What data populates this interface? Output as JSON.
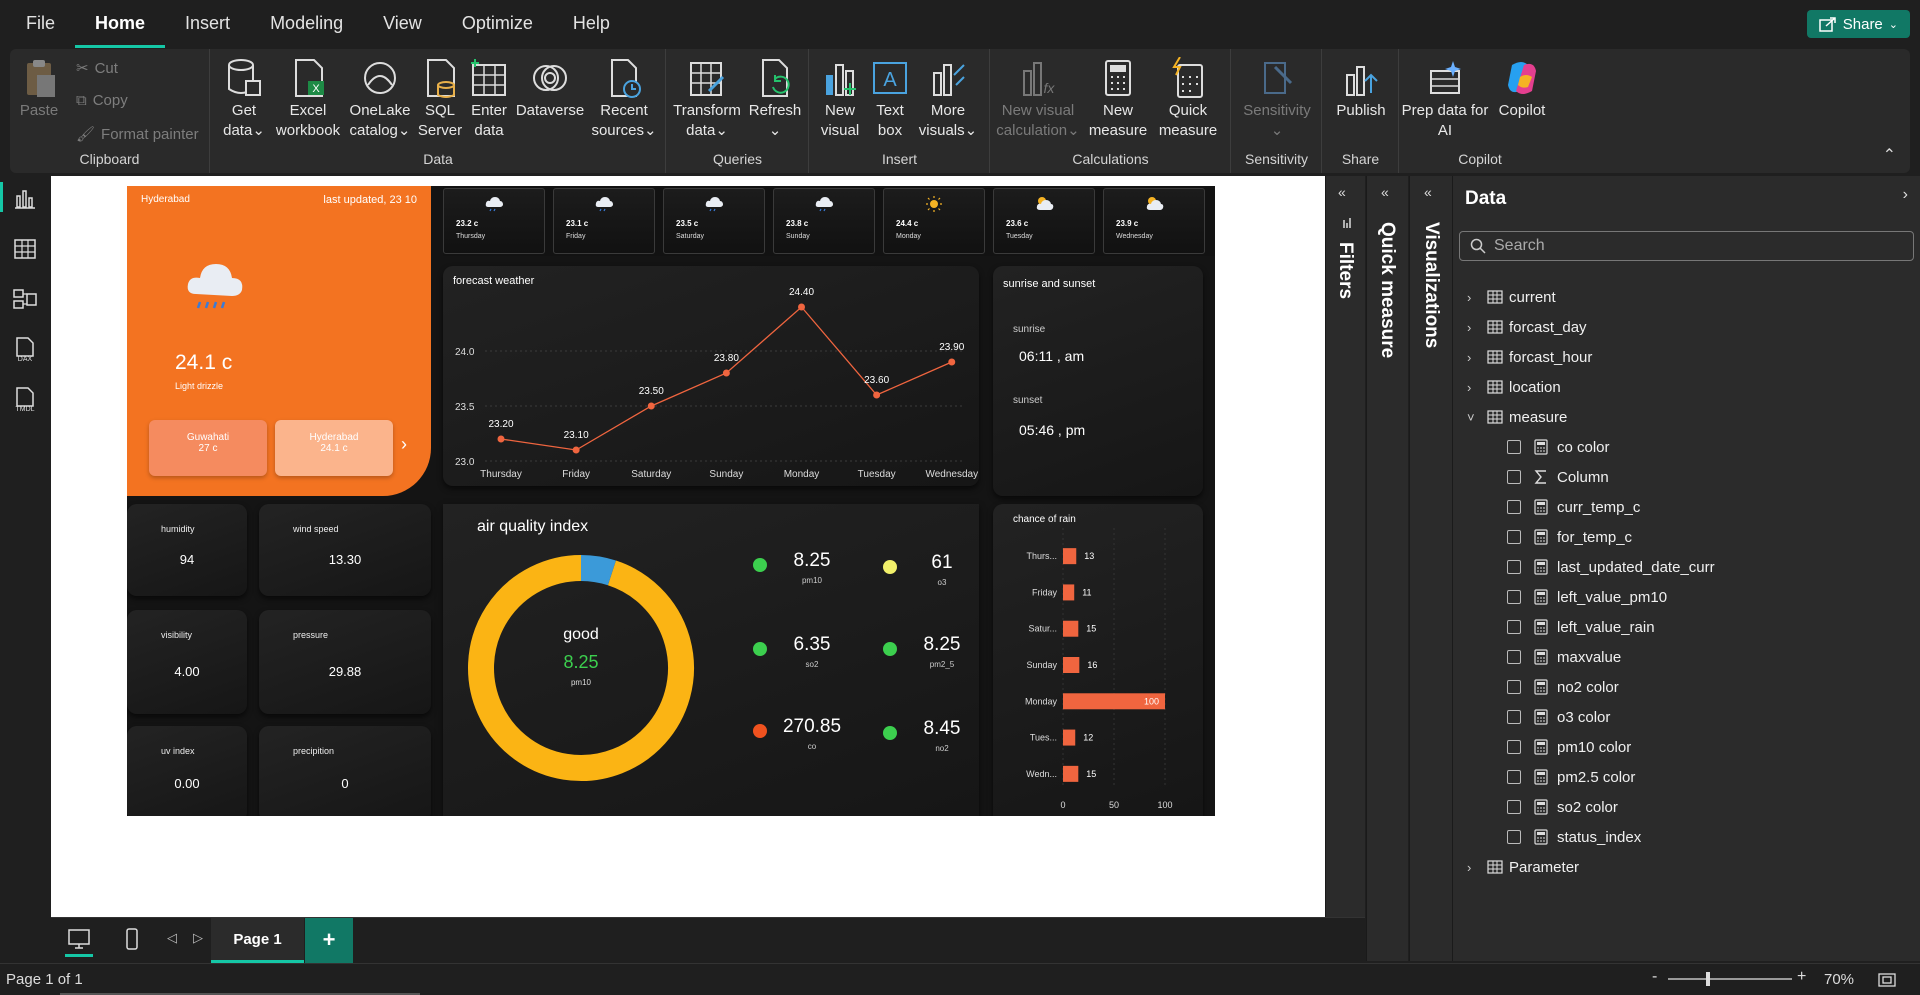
{
  "menu": {
    "items": [
      "File",
      "Home",
      "Insert",
      "Modeling",
      "View",
      "Optimize",
      "Help"
    ],
    "active": "Home",
    "share": "Share"
  },
  "ribbon": {
    "clipboard": {
      "paste": "Paste",
      "cut": "Cut",
      "copy": "Copy",
      "format_painter": "Format painter",
      "label": "Clipboard"
    },
    "data": {
      "get_data": [
        "Get",
        "data"
      ],
      "excel": [
        "Excel",
        "workbook"
      ],
      "onelake": [
        "OneLake",
        "catalog"
      ],
      "sql": [
        "SQL",
        "Server"
      ],
      "enter": [
        "Enter",
        "data"
      ],
      "dataverse": "Dataverse",
      "recent": [
        "Recent",
        "sources"
      ],
      "label": "Data"
    },
    "queries": {
      "transform": [
        "Transform",
        "data"
      ],
      "refresh": "Refresh",
      "label": "Queries"
    },
    "insert": {
      "new_visual": [
        "New",
        "visual"
      ],
      "text_box": [
        "Text",
        "box"
      ],
      "more_visuals": [
        "More",
        "visuals"
      ],
      "label": "Insert"
    },
    "calculations": {
      "new_visual_calc": [
        "New visual",
        "calculation"
      ],
      "new_measure": [
        "New",
        "measure"
      ],
      "quick_measure": [
        "Quick",
        "measure"
      ],
      "label": "Calculations"
    },
    "sensitivity": {
      "btn": "Sensitivity",
      "label": "Sensitivity"
    },
    "share": {
      "publish": "Publish",
      "label": "Share"
    },
    "copilot": {
      "prep": [
        "Prep data for",
        "AI"
      ],
      "copilot": "Copilot",
      "label": "Copilot"
    }
  },
  "report": {
    "current": {
      "city": "Hyderabad",
      "last_updated": "last updated, 23 10",
      "temp": "24.1 c",
      "condition": "Light drizzle",
      "cities": [
        {
          "name": "Guwahati",
          "temp": "27 c"
        },
        {
          "name": "Hyderabad",
          "temp": "24.1 c"
        }
      ]
    },
    "daily": [
      {
        "temp": "23.2 c",
        "day": "Thursday",
        "icon": "cloud-rain-icon"
      },
      {
        "temp": "23.1 c",
        "day": "Friday",
        "icon": "cloud-rain-icon"
      },
      {
        "temp": "23.5 c",
        "day": "Saturday",
        "icon": "cloud-rain-icon"
      },
      {
        "temp": "23.8 c",
        "day": "Sunday",
        "icon": "cloud-rain-icon"
      },
      {
        "temp": "24.4 c",
        "day": "Monday",
        "icon": "sun-icon"
      },
      {
        "temp": "23.6 c",
        "day": "Tuesday",
        "icon": "partly-cloudy-icon"
      },
      {
        "temp": "23.9 c",
        "day": "Wednesday",
        "icon": "partly-cloudy-icon"
      }
    ],
    "metrics": [
      {
        "label": "humidity",
        "value": "94"
      },
      {
        "label": "wind speed",
        "value": "13.30"
      },
      {
        "label": "visibility",
        "value": "4.00"
      },
      {
        "label": "pressure",
        "value": "29.88"
      },
      {
        "label": "uv index",
        "value": "0.00"
      },
      {
        "label": "precipition",
        "value": "0"
      }
    ],
    "sun": {
      "title": "sunrise and sunset",
      "sunrise_label": "sunrise",
      "sunrise": "06:11 , am",
      "sunset_label": "sunset",
      "sunset": "05:46 , pm"
    },
    "aqi": {
      "title": "air quality index",
      "status": "good",
      "value": "8.25",
      "unit": "pm10",
      "items": [
        {
          "value": "8.25",
          "label": "pm10",
          "color": "#3ccf4e"
        },
        {
          "value": "61",
          "label": "o3",
          "color": "#f2f06a"
        },
        {
          "value": "6.35",
          "label": "so2",
          "color": "#3ccf4e"
        },
        {
          "value": "8.25",
          "label": "pm2_5",
          "color": "#3ccf4e"
        },
        {
          "value": "270.85",
          "label": "co",
          "color": "#f0521f"
        },
        {
          "value": "8.45",
          "label": "no2",
          "color": "#3ccf4e"
        }
      ]
    }
  },
  "chart_data": [
    {
      "type": "line",
      "title": "forecast weather",
      "categories": [
        "Thursday",
        "Friday",
        "Saturday",
        "Sunday",
        "Monday",
        "Tuesday",
        "Wednesday"
      ],
      "values": [
        23.2,
        23.1,
        23.5,
        23.8,
        24.4,
        23.6,
        23.9
      ],
      "value_labels": [
        "23.20",
        "23.10",
        "23.50",
        "23.80",
        "24.40",
        "23.60",
        "23.90"
      ],
      "yticks": [
        "23.0",
        "23.5",
        "24.0"
      ],
      "ylim": [
        23.0,
        24.5
      ],
      "color": "#f0653f"
    },
    {
      "type": "bar",
      "title": "chance of rain",
      "categories": [
        "Thurs...",
        "Friday",
        "Satur...",
        "Sunday",
        "Monday",
        "Tues...",
        "Wedn..."
      ],
      "values": [
        13,
        11,
        15,
        16,
        100,
        12,
        15
      ],
      "xticks": [
        "0",
        "50",
        "100"
      ],
      "xlim": [
        0,
        100
      ],
      "color": "#f0653f"
    },
    {
      "type": "pie",
      "title": "air quality index",
      "slices": [
        {
          "value": 95,
          "color": "#fbb414"
        },
        {
          "value": 5,
          "color": "#3b9ad9"
        }
      ]
    }
  ],
  "panes": {
    "filters": "Filters",
    "quick_measure": "Quick measure",
    "visualizations": "Visualizations",
    "data": "Data"
  },
  "data_pane": {
    "search_placeholder": "Search",
    "tables": [
      {
        "name": "current",
        "expanded": false
      },
      {
        "name": "forcast_day",
        "expanded": false
      },
      {
        "name": "forcast_hour",
        "expanded": false
      },
      {
        "name": "location",
        "expanded": false
      },
      {
        "name": "measure",
        "expanded": true
      },
      {
        "name": "Parameter",
        "expanded": false
      }
    ],
    "measure_fields": [
      "co color",
      "Column",
      "curr_temp_c",
      "for_temp_c",
      "last_updated_date_curr",
      "left_value_pm10",
      "left_value_rain",
      "maxvalue",
      "no2 color",
      "o3 color",
      "pm10 color",
      "pm2.5 color",
      "so2 color",
      "status_index"
    ]
  },
  "pages": {
    "current": "Page 1",
    "add": "+"
  },
  "status": {
    "page_info": "Page 1 of 1",
    "zoom": "70%"
  }
}
